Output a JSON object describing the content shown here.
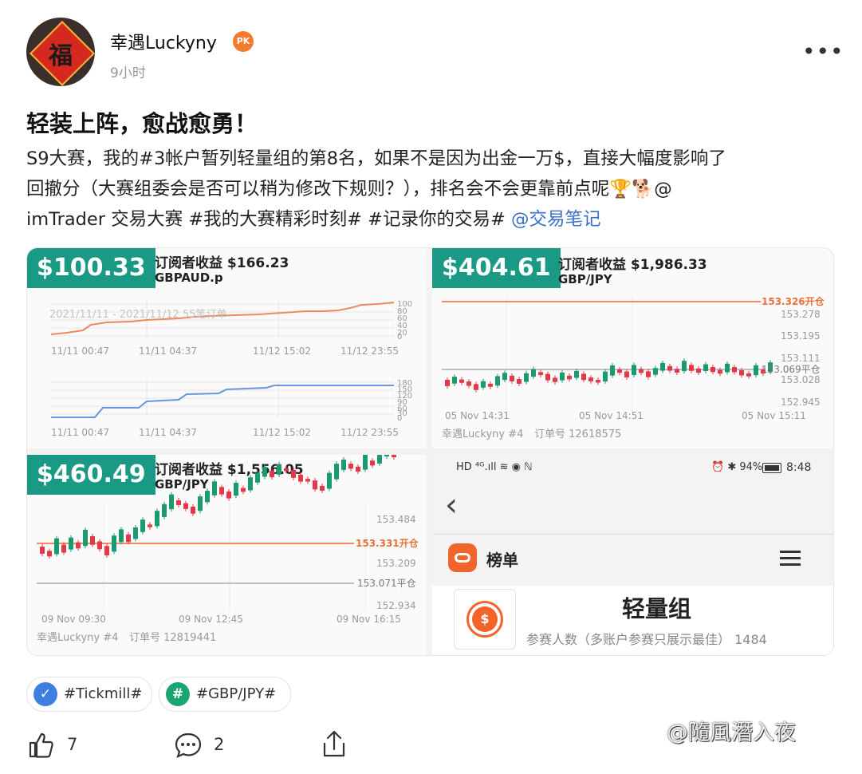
{
  "post": {
    "author": "幸遇Luckyny",
    "badge": "PK",
    "avatar_glyph": "福",
    "time": "9小时",
    "more": "•••",
    "title": "轻装上阵，愈战愈勇！",
    "body_line1": "S9大赛，我的#3帐户暂列轻量组的第8名，如果不是因为出金一万$，直接大幅度影响了",
    "body_line2": "回撤分（大赛组委会是否可以稍为修改下规则？），排名会不会更靠前点呢🏆🐕@",
    "body_line3_a": "imTrader 交易大赛 #我的大赛精彩时刻# #记录你的交易# ",
    "body_line3_link": "@交易笔记"
  },
  "panels": {
    "p1": {
      "amount": "$100.33",
      "profit": "订阅者收益 $166.23",
      "symbol": "GBPAUD.p",
      "range_label": "2021/11/11 - 2021/11/12  55笔订单",
      "axis1": [
        "100",
        "80",
        "60",
        "40",
        "20",
        "0"
      ],
      "axis2": [
        "180",
        "150",
        "120",
        "90",
        "60",
        "30",
        "0"
      ],
      "xlabels": [
        "11/11 00:47",
        "11/11 04:37",
        "11/12 15:02",
        "11/12 23:55"
      ]
    },
    "p2": {
      "amount": "$404.61",
      "profit": "订阅者收益 $1,986.33",
      "symbol": "GBP/JPY",
      "open_label": "153.326开仓",
      "close_label": "153.069平仓",
      "prices": [
        "153.278",
        "153.195",
        "153.111",
        "153.028",
        "152.945"
      ],
      "xlabels": [
        "05 Nov  14:31",
        "05 Nov  14:51",
        "05 Nov  15:11"
      ],
      "footer_user": "幸遇Luckyny #4",
      "footer_order": "订单号 12618575"
    },
    "p3": {
      "amount": "$460.49",
      "profit": "订阅者收益 $1,556.05",
      "symbol": "GBP/JPY",
      "open_label": "153.331开仓",
      "close_label": "153.071平仓",
      "prices": [
        "153.484",
        "153.209",
        "152.934"
      ],
      "xlabels": [
        "09 Nov  09:30",
        "09 Nov  12:45",
        "09 Nov  16:15"
      ],
      "footer_user": "幸遇Luckyny #4",
      "footer_order": "订单号 12819441"
    },
    "p4": {
      "status_left": "HD ⁴ᴳ.ıll ≋ ◉ ℕ",
      "status_right": "⏰ ✱ 94%",
      "clock": "8:48",
      "back": "‹",
      "nav_title": "榜单",
      "group_title": "轻量组",
      "participants": "参赛人数（多账户参赛只展示最佳）  1484",
      "coin": "$"
    }
  },
  "topics": [
    {
      "label": "#Tickmill#",
      "icon": "✓",
      "color": "#3d7fe0"
    },
    {
      "label": "#GBP/JPY#",
      "icon": "#",
      "color": "#1aa572"
    }
  ],
  "actions": {
    "likes": "7",
    "comments": "2"
  },
  "watermark": "@隨風潛入夜"
}
